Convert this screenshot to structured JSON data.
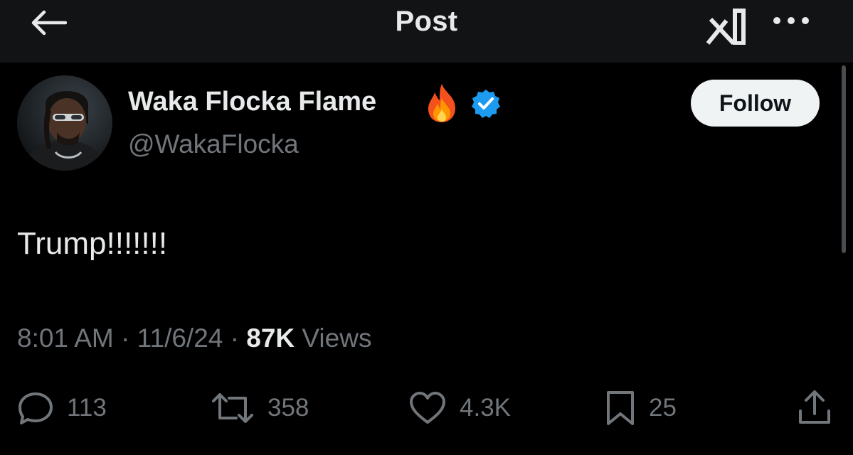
{
  "header": {
    "title": "Post",
    "back_icon": "arrow-left-icon",
    "grok_icon": "grok-icon",
    "more_icon": "more-horizontal-icon"
  },
  "author": {
    "display_name": "Waka Flocka Flame",
    "handle": "@WakaFlocka",
    "emoji": "🔥",
    "verified_color": "#1d9bf0"
  },
  "follow_label": "Follow",
  "post": {
    "text": "Trump!!!!!!!"
  },
  "meta": {
    "time": "8:01 AM",
    "separator": "·",
    "date": "11/6/24",
    "views_count": "87K",
    "views_label": "Views"
  },
  "actions": {
    "replies": "113",
    "reposts": "358",
    "likes": "4.3K",
    "bookmarks": "25"
  },
  "colors": {
    "background": "#000000",
    "header_bg": "#121314",
    "primary_text": "#e7e9ea",
    "secondary_text": "#71767b",
    "button_bg": "#eff3f4"
  }
}
